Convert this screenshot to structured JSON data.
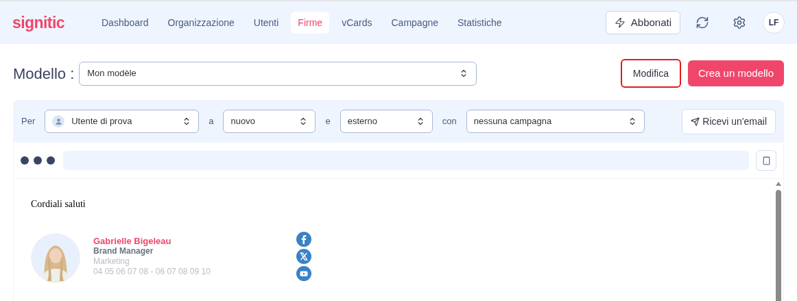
{
  "header": {
    "logo": "signitic",
    "nav": [
      {
        "label": "Dashboard",
        "selected": false
      },
      {
        "label": "Organizzazione",
        "selected": false
      },
      {
        "label": "Utenti",
        "selected": false
      },
      {
        "label": "Firme",
        "selected": true
      },
      {
        "label": "vCards",
        "selected": false
      },
      {
        "label": "Campagne",
        "selected": false
      },
      {
        "label": "Statistiche",
        "selected": false
      }
    ],
    "subscribe_button": "Abbonati",
    "avatar_initials": "LF"
  },
  "template": {
    "label": "Modello :",
    "value": "Mon modèle",
    "edit_button": {
      "label": "Modifica",
      "highlighted": true
    },
    "create_button": "Crea un modello"
  },
  "filters": {
    "items": [
      {
        "prefix": "Per",
        "value": "Utente di prova",
        "kind": "user"
      },
      {
        "prefix": "a",
        "value": "nuovo",
        "kind": "plain"
      },
      {
        "prefix": "e",
        "value": "esterno",
        "kind": "plain"
      },
      {
        "prefix": "con",
        "value": "nessuna campagna",
        "kind": "plain"
      }
    ],
    "email_button": "Ricevi un'email"
  },
  "preview": {
    "greeting": "Cordiali saluti",
    "signature": {
      "name": "Gabrielle Bigeleau",
      "title": "Brand Manager",
      "department": "Marketing",
      "phone": "04 05 06 07 08 - 06 07 08 09 10"
    },
    "social": [
      {
        "kind": "facebook"
      },
      {
        "kind": "x"
      },
      {
        "kind": "youtube"
      }
    ]
  }
}
